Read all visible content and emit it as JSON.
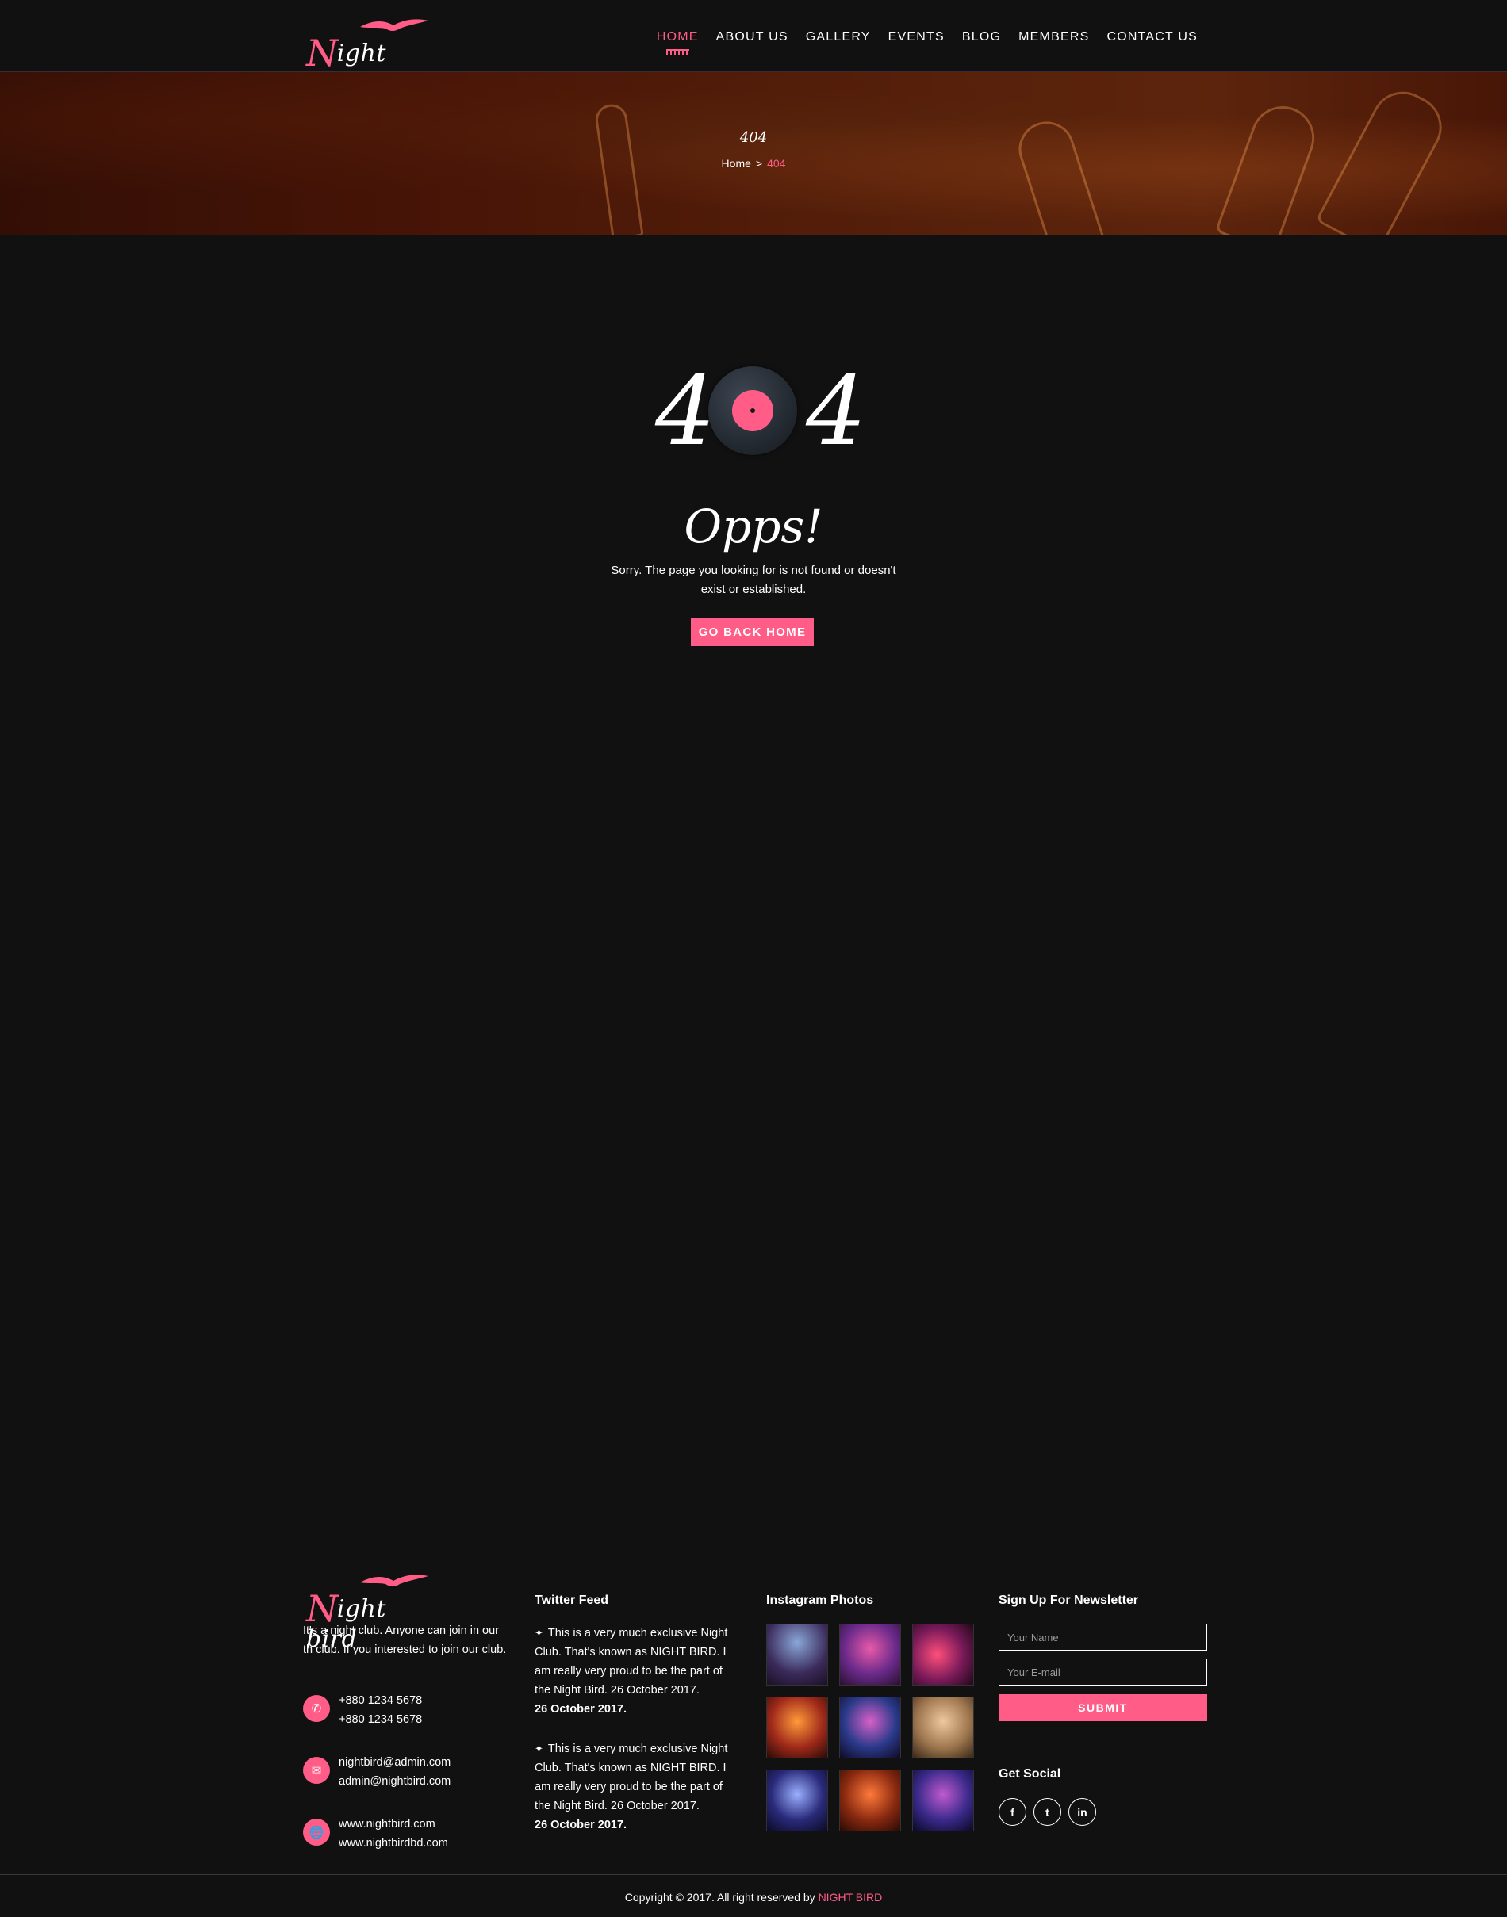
{
  "brand": {
    "script_cap": "N",
    "script_rest": "ight bird",
    "accent": "#ff5c87"
  },
  "nav": {
    "items": [
      {
        "label": "HOME",
        "active": true
      },
      {
        "label": "ABOUT US"
      },
      {
        "label": "GALLERY"
      },
      {
        "label": "EVENTS"
      },
      {
        "label": "BLOG"
      },
      {
        "label": "MEMBERS"
      },
      {
        "label": "CONTACT US"
      }
    ]
  },
  "banner": {
    "title": "404",
    "breadcrumb": {
      "home": "Home",
      "separator": ">",
      "current": "404"
    }
  },
  "error": {
    "left_digit": "4",
    "right_digit": "4",
    "heading": "Opps!",
    "message": "Sorry. The page you looking for is not found or doesn't exist or established.",
    "button": "GO BACK HOME"
  },
  "footer": {
    "about": "It's a night club. Anyone can join in our th club. If you interested to join our club.",
    "contacts": [
      {
        "icon": "phone-icon",
        "lines": [
          "+880 1234 5678",
          "+880 1234 5678"
        ]
      },
      {
        "icon": "envelope-icon",
        "lines": [
          "nightbird@admin.com",
          "admin@nightbird.com"
        ]
      },
      {
        "icon": "globe-icon",
        "lines": [
          "www.nightbird.com",
          "www.nightbirdbd.com"
        ]
      }
    ],
    "twitter": {
      "heading": "Twitter Feed",
      "tweets": [
        {
          "text": "This is a very much exclusive Night Club. That's known as NIGHT BIRD. I am really very proud to be the part of the Night Bird. 26 October 2017.",
          "date": "26 October 2017."
        },
        {
          "text": "This is a very much exclusive Night Club. That's known as NIGHT BIRD. I am really very proud to be the part of the Night Bird. 26 October 2017.",
          "date": "26 October 2017."
        }
      ]
    },
    "instagram": {
      "heading": "Instagram Photos"
    },
    "newsletter": {
      "heading": "Sign Up For Newsletter",
      "name_placeholder": "Your Name",
      "email_placeholder": "Your E-mail",
      "submit": "SUBMIT"
    },
    "social": {
      "heading": "Get Social",
      "icons": [
        {
          "name": "facebook-icon",
          "glyph": "f"
        },
        {
          "name": "twitter-icon",
          "glyph": "t"
        },
        {
          "name": "linkedin-icon",
          "glyph": "in"
        }
      ]
    },
    "copyright_prefix": "Copyright © 2017. All right reserved by",
    "copyright_brand": "NIGHT BIRD"
  }
}
